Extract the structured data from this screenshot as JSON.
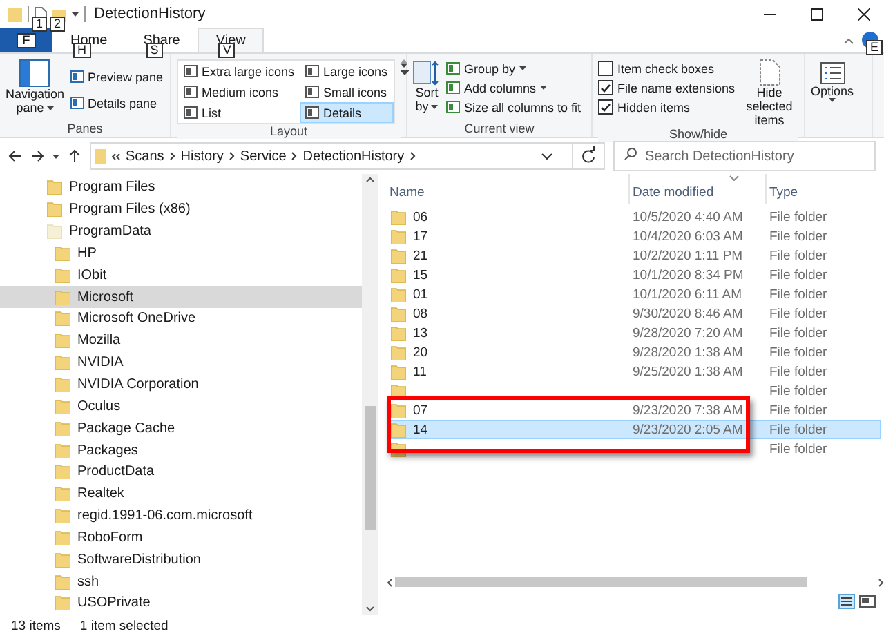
{
  "window": {
    "title": "DetectionHistory",
    "quick_access_key_tips": [
      "1",
      "2"
    ],
    "help_key_tip": "E"
  },
  "tabs": [
    {
      "kind": "file",
      "key_tip": "F",
      "selected": false
    },
    {
      "kind": "tab",
      "label": "Home",
      "key_tip": "H",
      "selected": false
    },
    {
      "kind": "tab",
      "label": "Share",
      "key_tip": "S",
      "selected": false
    },
    {
      "kind": "tab",
      "label": "View",
      "key_tip": "V",
      "selected": true
    }
  ],
  "ribbon": {
    "panes": {
      "label": "Panes",
      "navigation_pane": [
        "Navigation",
        "pane"
      ],
      "items": [
        "Preview pane",
        "Details pane"
      ]
    },
    "layout": {
      "label": "Layout",
      "items": [
        {
          "label": "Extra large icons",
          "selected": false
        },
        {
          "label": "Large icons",
          "selected": false
        },
        {
          "label": "Medium icons",
          "selected": false
        },
        {
          "label": "Small icons",
          "selected": false
        },
        {
          "label": "List",
          "selected": false
        },
        {
          "label": "Details",
          "selected": true
        }
      ]
    },
    "current_view": {
      "label": "Current view",
      "sort_by": [
        "Sort",
        "by"
      ],
      "items": [
        {
          "label": "Group by",
          "dropdown": true
        },
        {
          "label": "Add columns",
          "dropdown": true
        },
        {
          "label": "Size all columns to fit",
          "dropdown": false
        }
      ]
    },
    "show_hide": {
      "label": "Show/hide",
      "checkboxes": [
        {
          "label": "Item check boxes",
          "checked": false
        },
        {
          "label": "File name extensions",
          "checked": true
        },
        {
          "label": "Hidden items",
          "checked": true
        }
      ],
      "hide_selected": [
        "Hide selected",
        "items"
      ]
    },
    "options": {
      "label": "Options"
    }
  },
  "address": {
    "segments": [
      "Scans",
      "History",
      "Service",
      "DetectionHistory"
    ]
  },
  "search": {
    "placeholder": "Search DetectionHistory"
  },
  "navigation": {
    "items": [
      {
        "label": "Program Files",
        "hidden": false,
        "selected": false
      },
      {
        "label": "Program Files (x86)",
        "hidden": false,
        "selected": false
      },
      {
        "label": "ProgramData",
        "hidden": true,
        "selected": false,
        "children": [
          {
            "label": "HP",
            "selected": false
          },
          {
            "label": "IObit",
            "selected": false
          },
          {
            "label": "Microsoft",
            "selected": true
          },
          {
            "label": "Microsoft OneDrive",
            "selected": false
          },
          {
            "label": "Mozilla",
            "selected": false
          },
          {
            "label": "NVIDIA",
            "selected": false
          },
          {
            "label": "NVIDIA Corporation",
            "selected": false
          },
          {
            "label": "Oculus",
            "selected": false
          },
          {
            "label": "Package Cache",
            "selected": false
          },
          {
            "label": "Packages",
            "selected": false
          },
          {
            "label": "ProductData",
            "selected": false
          },
          {
            "label": "Realtek",
            "selected": false
          },
          {
            "label": "regid.1991-06.com.microsoft",
            "selected": false
          },
          {
            "label": "RoboForm",
            "selected": false
          },
          {
            "label": "SoftwareDistribution",
            "selected": false
          },
          {
            "label": "ssh",
            "selected": false
          },
          {
            "label": "USOPrivate",
            "selected": false
          }
        ]
      }
    ]
  },
  "table": {
    "columns": [
      {
        "label": "Name",
        "sorted": false
      },
      {
        "label": "Date modified",
        "sorted": true
      },
      {
        "label": "Type",
        "sorted": false
      }
    ],
    "rows": [
      {
        "name": "06",
        "date": "10/5/2020 4:40 AM",
        "type": "File folder",
        "selected": false
      },
      {
        "name": "17",
        "date": "10/4/2020 6:03 AM",
        "type": "File folder",
        "selected": false
      },
      {
        "name": "21",
        "date": "10/2/2020 1:11 PM",
        "type": "File folder",
        "selected": false
      },
      {
        "name": "15",
        "date": "10/1/2020 8:34 PM",
        "type": "File folder",
        "selected": false
      },
      {
        "name": "01",
        "date": "10/1/2020 6:11 AM",
        "type": "File folder",
        "selected": false
      },
      {
        "name": "08",
        "date": "9/30/2020 8:46 AM",
        "type": "File folder",
        "selected": false
      },
      {
        "name": "13",
        "date": "9/28/2020 7:20 AM",
        "type": "File folder",
        "selected": false
      },
      {
        "name": "20",
        "date": "9/28/2020 1:38 AM",
        "type": "File folder",
        "selected": false
      },
      {
        "name": "11",
        "date": "9/25/2020 1:38 AM",
        "type": "File folder",
        "selected": false
      },
      {
        "type": "File folder",
        "selected": false
      },
      {
        "name": "07",
        "date": "9/23/2020 7:38 AM",
        "type": "File folder",
        "selected": false
      },
      {
        "name": "14",
        "date": "9/23/2020 2:05 AM",
        "type": "File folder",
        "selected": true
      },
      {
        "type": "File folder",
        "selected": false
      }
    ]
  },
  "status_bar": {
    "count": "13 items",
    "selection": "1 item selected"
  }
}
